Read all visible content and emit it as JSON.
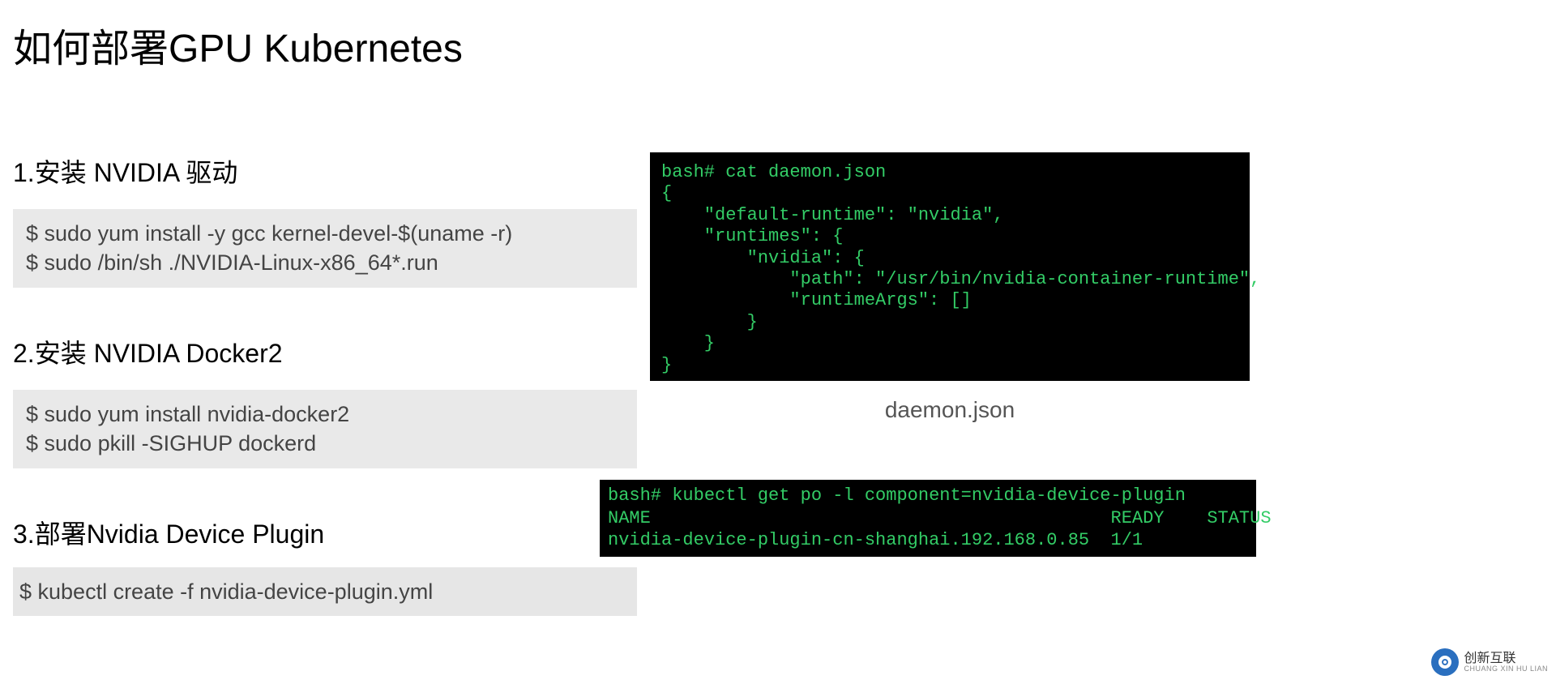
{
  "title": "如何部署GPU Kubernetes",
  "step1": {
    "heading": "1.安装 NVIDIA 驱动",
    "line1": "$ sudo yum install -y gcc kernel-devel-$(uname -r)",
    "line2": "$ sudo /bin/sh ./NVIDIA-Linux-x86_64*.run"
  },
  "step2": {
    "heading": "2.安装 NVIDIA Docker2",
    "line1": "$ sudo yum install nvidia-docker2",
    "line2": "$ sudo pkill -SIGHUP dockerd"
  },
  "step3": {
    "heading": "3.部署Nvidia Device Plugin",
    "line1": "$ kubectl create -f nvidia-device-plugin.yml"
  },
  "terminal1": {
    "content": "bash# cat daemon.json\n{\n    \"default-runtime\": \"nvidia\",\n    \"runtimes\": {\n        \"nvidia\": {\n            \"path\": \"/usr/bin/nvidia-container-runtime\",\n            \"runtimeArgs\": []\n        }\n    }\n}",
    "caption": "daemon.json"
  },
  "terminal2": {
    "content": "bash# kubectl get po -l component=nvidia-device-plugin\nNAME                                           READY    STATUS\nnvidia-device-plugin-cn-shanghai.192.168.0.85  1/1"
  },
  "watermark": {
    "text": "创新互联",
    "subtext": "CHUANG XIN HU LIAN"
  }
}
